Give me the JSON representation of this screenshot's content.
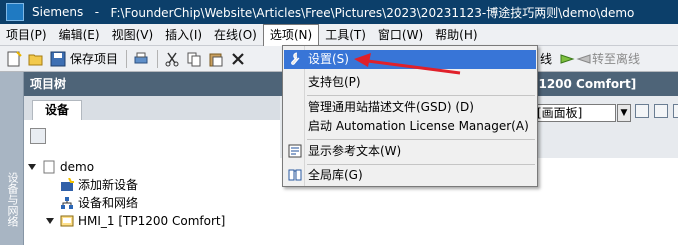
{
  "title": {
    "app": "Siemens",
    "path": "F:\\FounderChip\\Website\\Articles\\Free\\Pictures\\2023\\20231123-博途技巧两则\\demo\\demo"
  },
  "menubar": {
    "items": [
      "项目(P)",
      "编辑(E)",
      "视图(V)",
      "插入(I)",
      "在线(O)",
      "选项(N)",
      "工具(T)",
      "窗口(W)",
      "帮助(H)"
    ]
  },
  "toolbar": {
    "save_label": "保存项目",
    "go_offline_label": "转至离线",
    "online_partial": "线"
  },
  "dropdown": {
    "items": [
      {
        "label": "设置(S)",
        "icon": "wrench-icon"
      },
      {
        "label": "支持包(P)",
        "icon": ""
      },
      {
        "label": "管理通用站描述文件(GSD) (D)",
        "icon": ""
      },
      {
        "label": "启动 Automation License Manager(A)",
        "icon": ""
      },
      {
        "label": "显示参考文本(W)",
        "icon": "reference-text-icon"
      },
      {
        "label": "全局库(G)",
        "icon": "global-library-icon"
      }
    ]
  },
  "project_tree": {
    "header": "项目树",
    "tab": "设备",
    "vertical_tab": "设备与网络",
    "items": [
      {
        "label": "demo",
        "icon": "project-icon"
      },
      {
        "label": "添加新设备",
        "icon": "add-device-icon"
      },
      {
        "label": "设备和网络",
        "icon": "network-icon"
      },
      {
        "label": "HMI_1 [TP1200 Comfort]",
        "icon": "hmi-icon"
      }
    ]
  },
  "right_panel": {
    "header_suffix": "[TP1200 Comfort]",
    "combo_value": "[画面板]"
  },
  "colors": {
    "titlebar": "#0c3f6a",
    "panel_header": "#4e6478",
    "selection": "#3875d7",
    "annotation_arrow": "#e0202a"
  }
}
